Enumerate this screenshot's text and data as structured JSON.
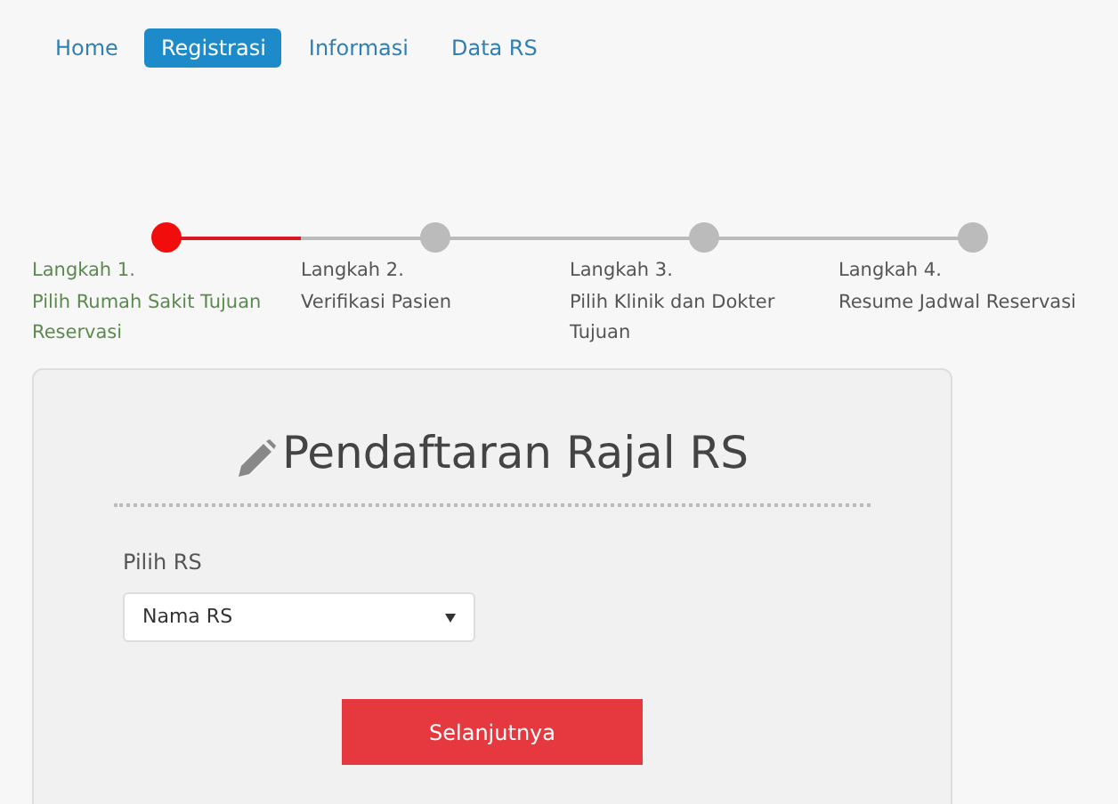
{
  "nav": [
    {
      "label": "Home",
      "selected": false
    },
    {
      "label": "Registrasi",
      "selected": true
    },
    {
      "label": "Informasi",
      "selected": false
    },
    {
      "label": "Data RS",
      "selected": false
    }
  ],
  "steps": [
    {
      "title": "Langkah 1.",
      "description": "Pilih Rumah Sakit Tujuan Reservasi",
      "selected": true
    },
    {
      "title": "Langkah 2.",
      "description": "Verifikasi Pasien",
      "selected": false
    },
    {
      "title": "Langkah 3.",
      "description": "Pilih Klinik dan Dokter Tujuan",
      "selected": false
    },
    {
      "title": "Langkah 4.",
      "description": "Resume Jadwal Reservasi",
      "selected": false
    }
  ],
  "form": {
    "title": "Pendaftaran Rajal RS",
    "field_label": "Pilih RS",
    "select_value": "Nama RS",
    "submit": "Selanjutnya"
  }
}
